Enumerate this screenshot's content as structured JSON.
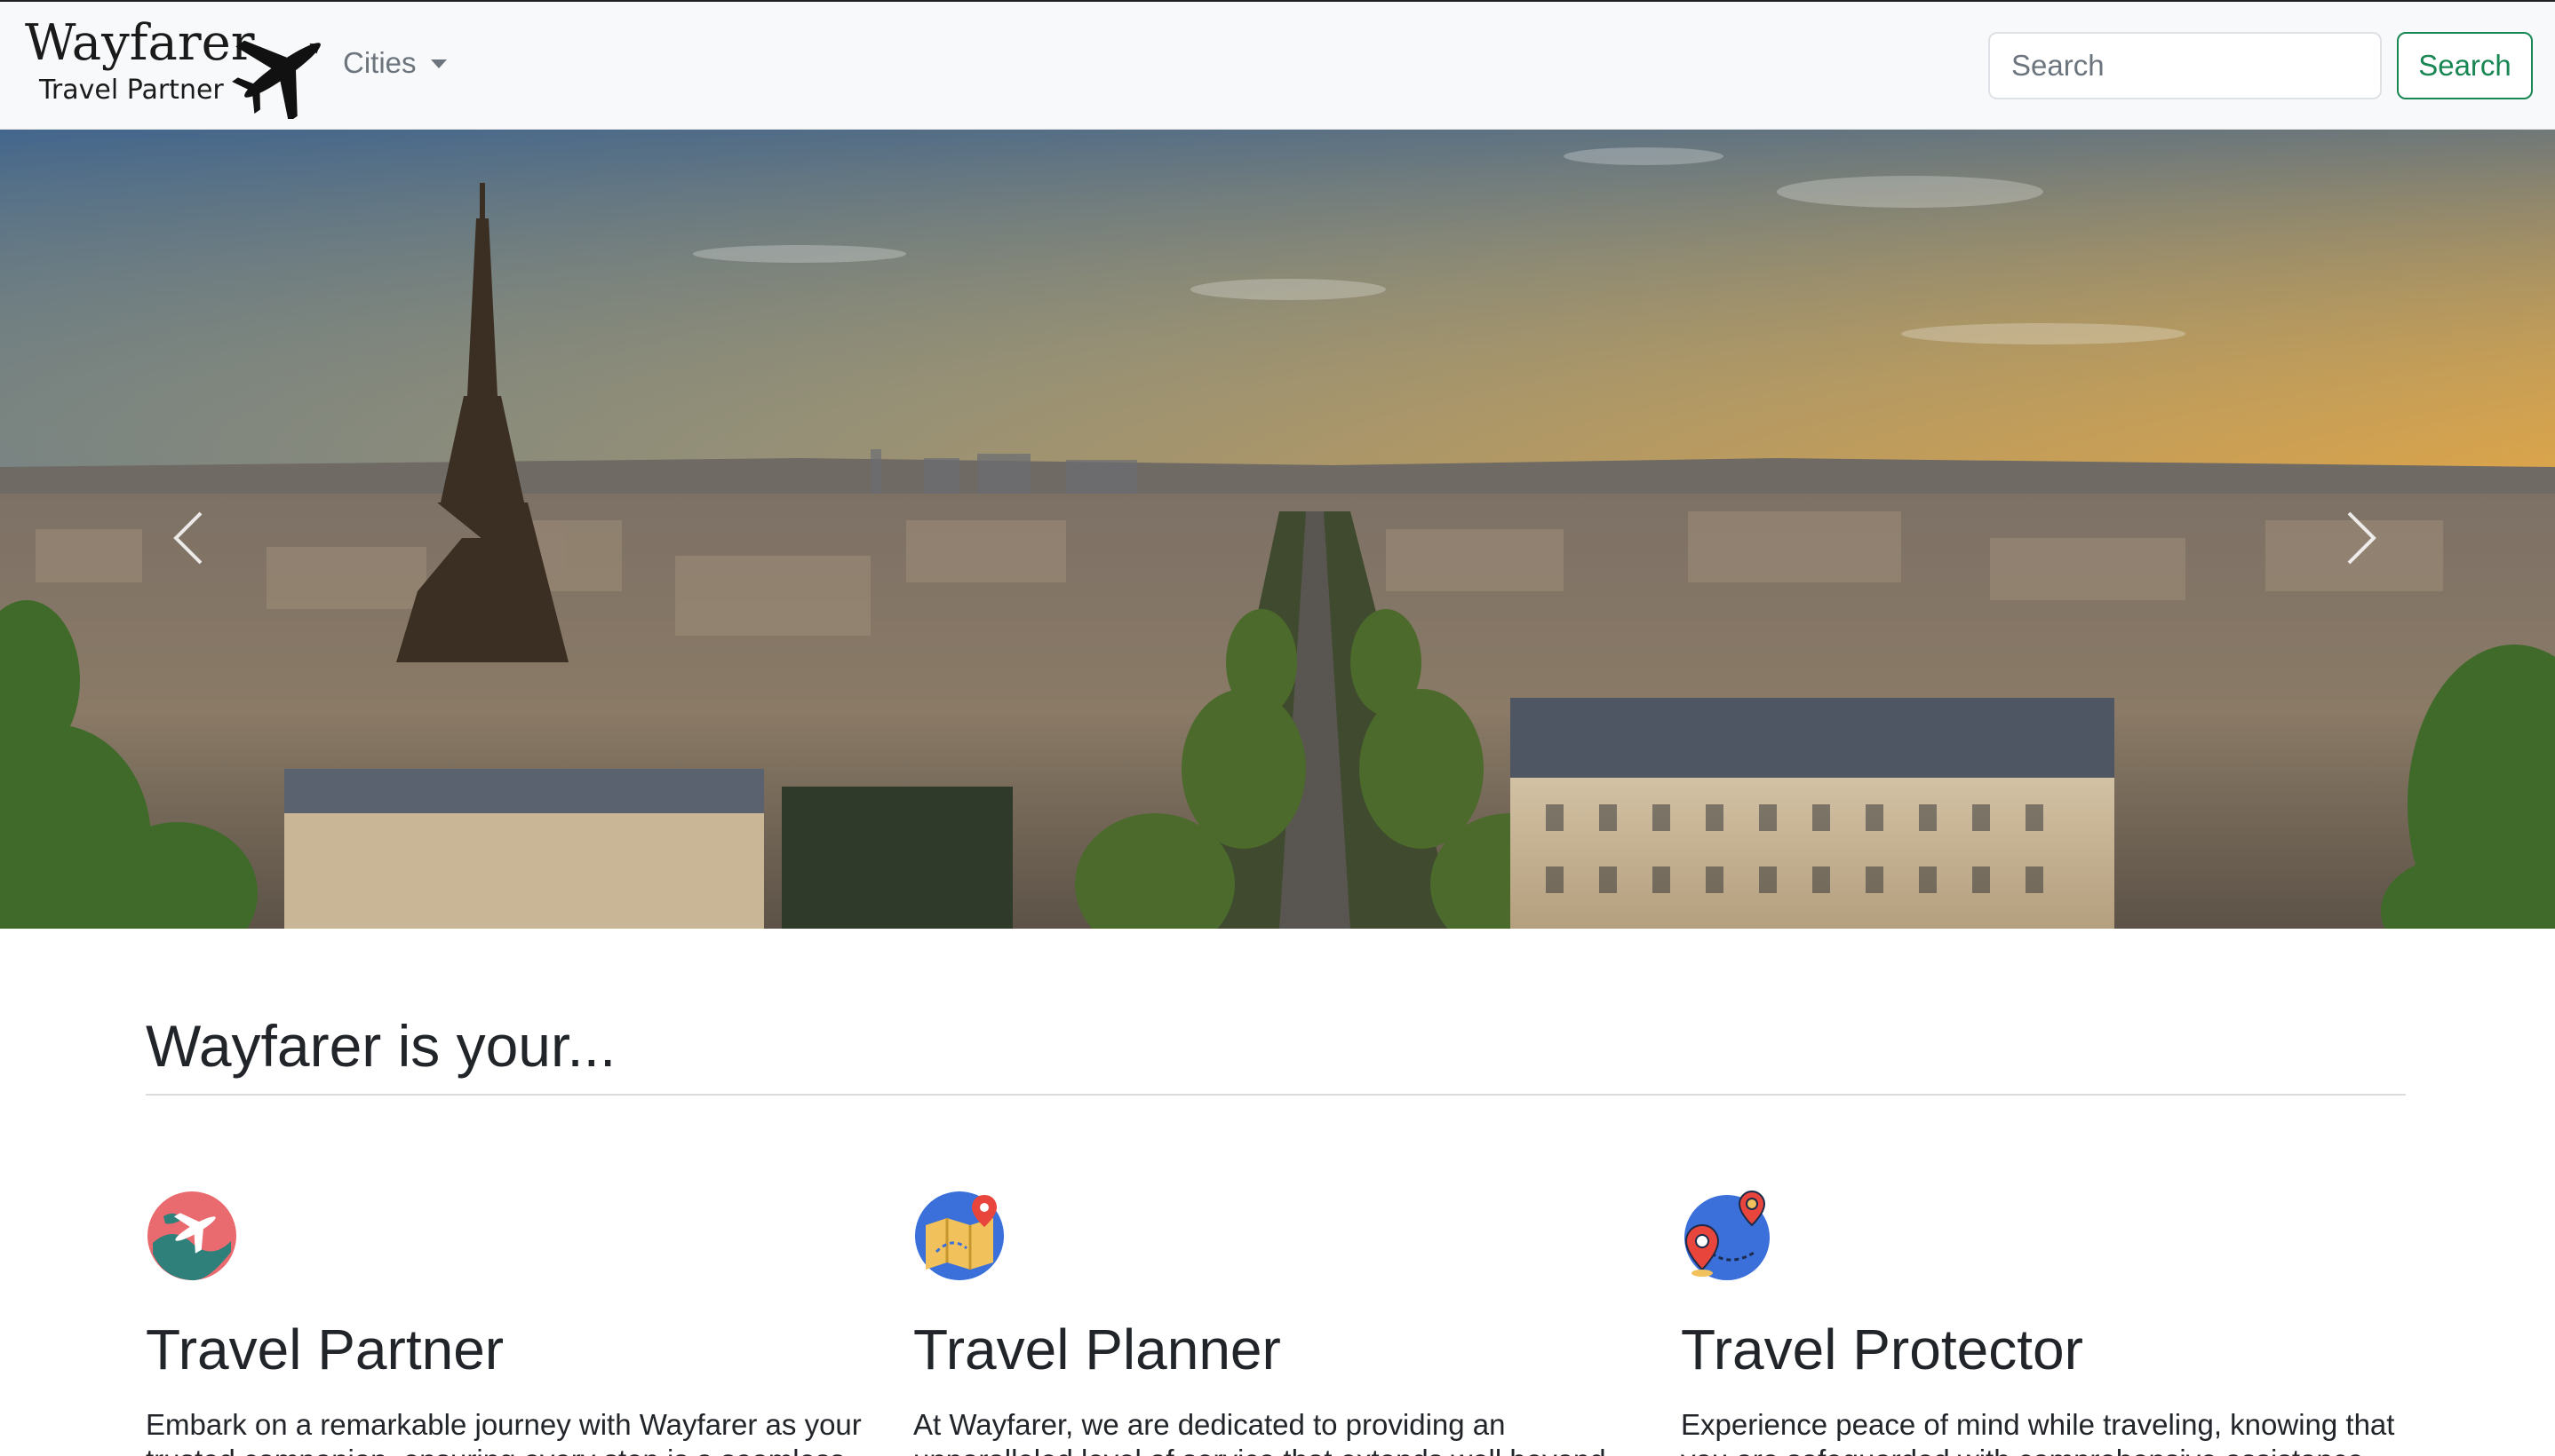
{
  "navbar": {
    "brand_title": "Wayfarer",
    "brand_subtitle": "Travel Partner",
    "brand_icon": "airplane-icon",
    "dropdown_label": "Cities",
    "search_placeholder": "Search",
    "search_button": "Search"
  },
  "hero": {
    "image": "paris-eiffel-tower-sunset-panorama",
    "prev_icon": "chevron-left-icon",
    "next_icon": "chevron-right-icon"
  },
  "section": {
    "title": "Wayfarer is your..."
  },
  "features": [
    {
      "icon": "globe-plane-icon",
      "title": "Travel Partner",
      "text": "Embark on a remarkable journey with Wayfarer as your trusted companion, ensuring every step is a seamless"
    },
    {
      "icon": "map-pin-icon",
      "title": "Travel Planner",
      "text": "At Wayfarer, we are dedicated to providing an unparalleled level of service that extends well beyond"
    },
    {
      "icon": "route-pins-icon",
      "title": "Travel Protector",
      "text": "Experience peace of mind while traveling, knowing that you are safeguarded with comprehensive assistance"
    }
  ],
  "colors": {
    "navbar_bg": "#f8f9fa",
    "search_button": "#198754",
    "text": "#212529",
    "muted": "#6c757d"
  }
}
